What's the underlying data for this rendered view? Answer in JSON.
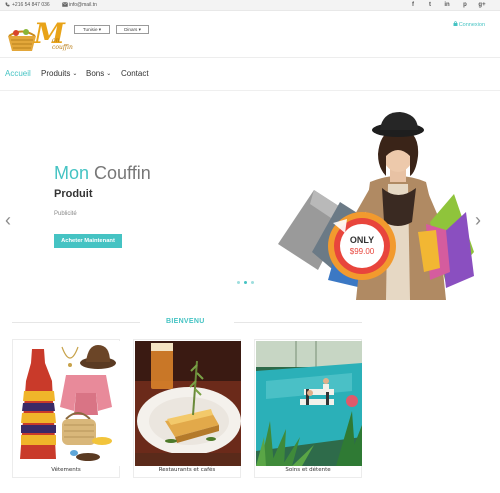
{
  "topbar": {
    "phone": "+216 54 847 036",
    "email": "info@mail.tn",
    "socials": [
      {
        "icon": "facebook-icon",
        "glyph": "f"
      },
      {
        "icon": "twitter-icon",
        "glyph": "t"
      },
      {
        "icon": "linkedin-icon",
        "glyph": "in"
      },
      {
        "icon": "pinterest-icon",
        "glyph": "p"
      },
      {
        "icon": "google-plus-icon",
        "glyph": "g+"
      }
    ]
  },
  "header": {
    "logo_letter": "M",
    "logo_text": "on couffin",
    "select_1": "Tunisie ▾",
    "select_2": "Dinars ▾",
    "login": "Connexion"
  },
  "nav": {
    "items": [
      {
        "label": "Accueil",
        "active": true,
        "dropdown": false
      },
      {
        "label": "Produits",
        "active": false,
        "dropdown": true
      },
      {
        "label": "Bons",
        "active": false,
        "dropdown": true
      },
      {
        "label": "Contact",
        "active": false,
        "dropdown": false
      }
    ]
  },
  "hero": {
    "title_part1": "Mon",
    "title_part2": "Couffin",
    "subtitle": "Produit",
    "description": "Publicité",
    "cta": "Acheter Maintenant",
    "badge_top": "ONLY",
    "badge_price": "$99.00",
    "prev": "‹",
    "next": "›",
    "slide_count": 3,
    "active_slide": 1
  },
  "section": {
    "title": "BIENVENU"
  },
  "cards": [
    {
      "caption": "Vêtements"
    },
    {
      "caption": "Restaurants et cafés"
    },
    {
      "caption": "Soins et détente"
    }
  ],
  "colors": {
    "accent": "#45c3c3",
    "logo": "#e8a318",
    "badge_red": "#e8453c",
    "badge_orange": "#f29a2e"
  }
}
